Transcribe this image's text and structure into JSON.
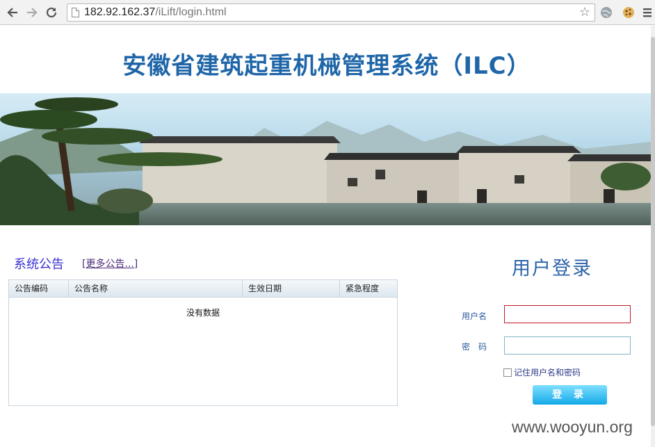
{
  "browser": {
    "url_host": "182.92.162.37",
    "url_path": "/iLift/login.html"
  },
  "page": {
    "title": "安徽省建筑起重机械管理系统（ILC）"
  },
  "announcements": {
    "title": "系统公告",
    "more_link": "[更多公告...]",
    "columns": [
      "公告编码",
      "公告名称",
      "生效日期",
      "紧急程度"
    ],
    "empty_text": "没有数据"
  },
  "login": {
    "title": "用户登录",
    "username_label": "用户名",
    "password_label": "密　码",
    "username_value": "",
    "password_value": "",
    "remember_label": "记住用户名和密码",
    "remember_checked": false,
    "submit_label": "登 录"
  },
  "watermark": "www.wooyun.org"
}
